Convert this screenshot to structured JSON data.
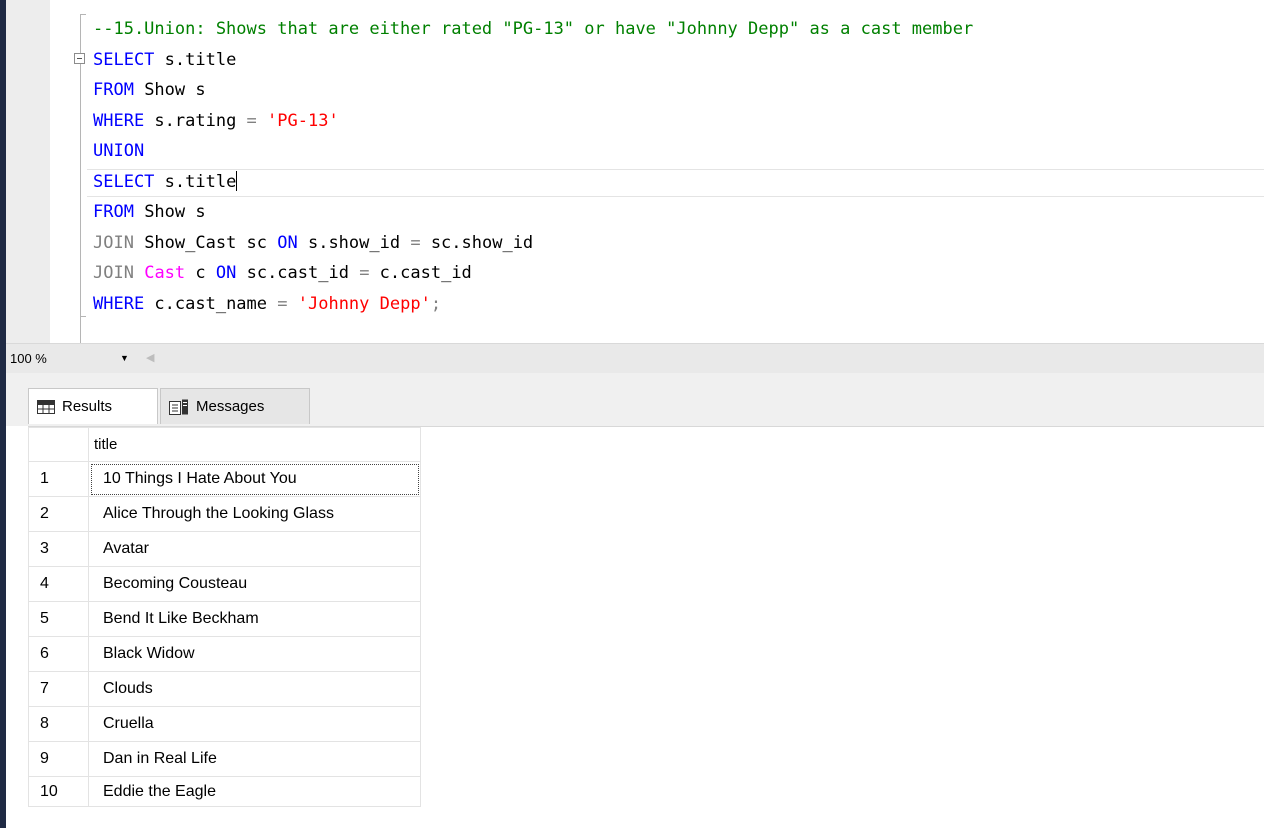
{
  "editor": {
    "lines": [
      [
        {
          "t": "--15.Union: Shows that are either rated \"PG-13\" or have \"Johnny Depp\" as a cast member",
          "c": "cm"
        }
      ],
      [
        {
          "t": "SELECT",
          "c": "kw"
        },
        {
          "t": " s.title",
          "c": ""
        }
      ],
      [
        {
          "t": "FROM",
          "c": "kw"
        },
        {
          "t": " Show s",
          "c": ""
        }
      ],
      [
        {
          "t": "WHERE",
          "c": "kw"
        },
        {
          "t": " s.rating ",
          "c": ""
        },
        {
          "t": "=",
          "c": "gray"
        },
        {
          "t": " ",
          "c": ""
        },
        {
          "t": "'PG-13'",
          "c": "str"
        }
      ],
      [
        {
          "t": "UNION",
          "c": "kw"
        }
      ],
      [
        {
          "t": "SELECT",
          "c": "kw"
        },
        {
          "t": " s.title",
          "c": ""
        }
      ],
      [
        {
          "t": "FROM",
          "c": "kw"
        },
        {
          "t": " Show s",
          "c": ""
        }
      ],
      [
        {
          "t": "JOIN",
          "c": "gray"
        },
        {
          "t": " Show_Cast sc ",
          "c": ""
        },
        {
          "t": "ON",
          "c": "kw"
        },
        {
          "t": " s.show_id ",
          "c": ""
        },
        {
          "t": "=",
          "c": "gray"
        },
        {
          "t": " sc.show_id",
          "c": ""
        }
      ],
      [
        {
          "t": "JOIN",
          "c": "gray"
        },
        {
          "t": " ",
          "c": ""
        },
        {
          "t": "Cast",
          "c": "pink"
        },
        {
          "t": " c ",
          "c": ""
        },
        {
          "t": "ON",
          "c": "kw"
        },
        {
          "t": " sc.cast_id ",
          "c": ""
        },
        {
          "t": "=",
          "c": "gray"
        },
        {
          "t": " c.cast_id",
          "c": ""
        }
      ],
      [
        {
          "t": "WHERE",
          "c": "kw"
        },
        {
          "t": " c.cast_name ",
          "c": ""
        },
        {
          "t": "=",
          "c": "gray"
        },
        {
          "t": " ",
          "c": ""
        },
        {
          "t": "'Johnny Depp'",
          "c": "str"
        },
        {
          "t": ";",
          "c": "gray"
        }
      ]
    ],
    "current_line": 5
  },
  "zoom": {
    "value": "100 %"
  },
  "tabs": {
    "results": "Results",
    "messages": "Messages"
  },
  "grid": {
    "column": "title",
    "rows": [
      {
        "n": "1",
        "title": "10 Things I Hate About You"
      },
      {
        "n": "2",
        "title": "Alice Through the Looking Glass"
      },
      {
        "n": "3",
        "title": "Avatar"
      },
      {
        "n": "4",
        "title": "Becoming Cousteau"
      },
      {
        "n": "5",
        "title": "Bend It Like Beckham"
      },
      {
        "n": "6",
        "title": "Black Widow"
      },
      {
        "n": "7",
        "title": "Clouds"
      },
      {
        "n": "8",
        "title": "Cruella"
      },
      {
        "n": "9",
        "title": "Dan in Real Life"
      },
      {
        "n": "10",
        "title": "Eddie the Eagle"
      }
    ]
  }
}
